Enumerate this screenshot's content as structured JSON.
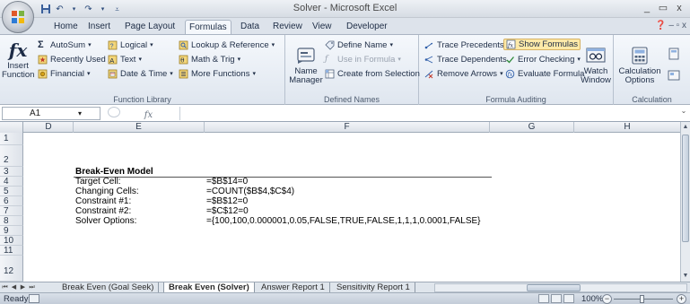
{
  "window": {
    "title": "Solver - Microsoft Excel",
    "minimize": "_",
    "maximize": "▭",
    "close": "x"
  },
  "ribbon_tabs": [
    "Home",
    "Insert",
    "Page Layout",
    "Formulas",
    "Data",
    "Review",
    "View",
    "Developer"
  ],
  "active_tab": "Formulas",
  "ribbon": {
    "function_library": {
      "label": "Function Library",
      "insert_function": "Insert Function",
      "insert_function_line1": "Insert",
      "insert_function_line2": "Function",
      "fx_symbol": "fx",
      "autosum": "AutoSum",
      "recently_used": "Recently Used",
      "financial": "Financial",
      "logical": "Logical",
      "text": "Text",
      "date_time": "Date & Time",
      "lookup_reference": "Lookup & Reference",
      "math_trig": "Math & Trig",
      "more_functions": "More Functions"
    },
    "defined_names": {
      "label": "Defined Names",
      "name_manager_line1": "Name",
      "name_manager_line2": "Manager",
      "define_name": "Define Name",
      "use_in_formula": "Use in Formula",
      "create_from_selection": "Create from Selection"
    },
    "formula_auditing": {
      "label": "Formula Auditing",
      "trace_precedents": "Trace Precedents",
      "trace_dependents": "Trace Dependents",
      "remove_arrows": "Remove Arrows",
      "show_formulas": "Show Formulas",
      "error_checking": "Error Checking",
      "evaluate_formula": "Evaluate Formula",
      "watch_window_line1": "Watch",
      "watch_window_line2": "Window"
    },
    "calculation": {
      "label": "Calculation",
      "options_line1": "Calculation",
      "options_line2": "Options"
    }
  },
  "formula_bar": {
    "name_box": "A1",
    "fx": "fx",
    "content": ""
  },
  "columns": [
    "D",
    "E",
    "F",
    "G",
    "H"
  ],
  "rows": [
    "1",
    "2",
    "3",
    "4",
    "5",
    "6",
    "7",
    "8",
    "9",
    "10",
    "11",
    "12"
  ],
  "cells": {
    "title": "Break-Even Model",
    "labels": [
      "Target Cell:",
      "Changing Cells:",
      "Constraint #1:",
      "Constraint #2:",
      "Solver Options:"
    ],
    "values": [
      "=$B$14=0",
      "=COUNT($B$4,$C$4)",
      "=$B$12=0",
      "=$C$12=0",
      "={100,100,0.000001,0.05,FALSE,TRUE,FALSE,1,1,1,0.0001,FALSE}"
    ]
  },
  "sheet_tabs": [
    "Break Even (Goal Seek)",
    "Break Even (Solver)",
    "Answer Report 1",
    "Sensitivity Report 1"
  ],
  "active_sheet": "Break Even (Solver)",
  "status": {
    "ready": "Ready",
    "zoom": "100%",
    "zoom_out": "−",
    "zoom_in": "+"
  }
}
